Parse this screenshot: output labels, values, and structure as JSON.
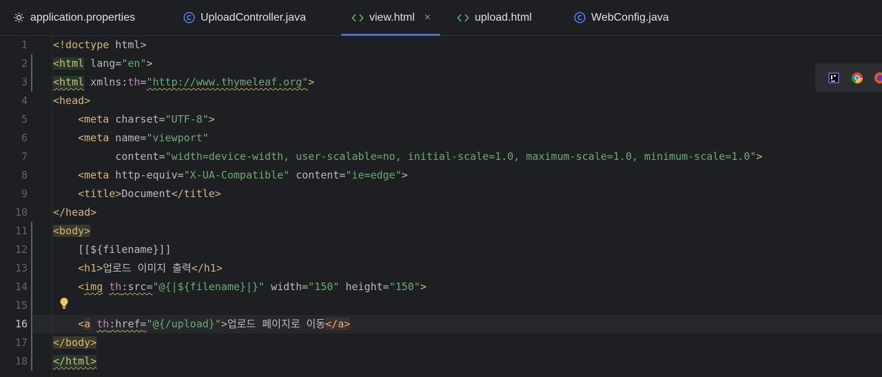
{
  "tabs": [
    {
      "label": "application.properties",
      "icon": "gear-icon"
    },
    {
      "label": "UploadController.java",
      "icon": "class-icon"
    },
    {
      "label": "view.html",
      "icon": "html-icon",
      "active": true
    },
    {
      "label": "upload.html",
      "icon": "html-icon"
    },
    {
      "label": "WebConfig.java",
      "icon": "class-icon"
    }
  ],
  "close_glyph": "×",
  "line_numbers": [
    "1",
    "2",
    "3",
    "4",
    "5",
    "6",
    "7",
    "8",
    "9",
    "10",
    "11",
    "12",
    "13",
    "14",
    "15",
    "16",
    "17",
    "18"
  ],
  "code": {
    "l1": {
      "a": "<!doctype",
      "b": " html",
      "c": ">"
    },
    "l2": {
      "a": "<html",
      "b": " lang=",
      "c": "\"en\"",
      "d": ">"
    },
    "l3": {
      "a": "<html",
      "b": " xmlns:",
      "c": "th",
      "d": "=",
      "e": "\"http://www.thymeleaf.org\"",
      "f": ">"
    },
    "l4": {
      "a": "<head>"
    },
    "l5": {
      "a": "    <meta",
      "b": " charset=",
      "c": "\"UTF-8\"",
      "d": ">"
    },
    "l6": {
      "a": "    <meta",
      "b": " name=",
      "c": "\"viewport\""
    },
    "l7": {
      "b": "          content=",
      "c": "\"width=device-width, user-scalable=no, initial-scale=1.0, maximum-scale=1.0, minimum-scale=1.0\"",
      "d": ">"
    },
    "l8": {
      "a": "    <meta",
      "b": " http-equiv=",
      "c": "\"X-UA-Compatible\"",
      "d": " content=",
      "e": "\"ie=edge\"",
      "f": ">"
    },
    "l9": {
      "a": "    <title>",
      "b": "Document",
      "c": "</title>"
    },
    "l10": {
      "a": "</head>"
    },
    "l11": {
      "a": "<body>"
    },
    "l12": {
      "a": "    [[${filename}]]"
    },
    "l13": {
      "a": "    <h1>",
      "b": "업로드 이미지 출력",
      "c": "</h1>"
    },
    "l14": {
      "a": "    <",
      "b": "img",
      "c": " ",
      "d": "th",
      "e": ":src=",
      "f": "\"@{|${filename}|}\"",
      "g": " width=",
      "h": "\"150\"",
      "i": " height=",
      "j": "\"150\"",
      "k": ">"
    },
    "l15": {
      "a": ""
    },
    "l16": {
      "a": "    <",
      "b": "a",
      "c": " ",
      "d": "th",
      "e": ":href=",
      "f": "\"@{/upload}\"",
      "g": ">",
      "h": "업로드 페이지로 이동",
      "i": "</a>"
    },
    "l17": {
      "a": "</body>"
    },
    "l18": {
      "a": "</html>"
    }
  },
  "colors": {
    "tag": "#d5b778",
    "attr": "#bababa",
    "value": "#6aab73",
    "namespace": "#c77dbb",
    "accent": "#3574f0"
  }
}
